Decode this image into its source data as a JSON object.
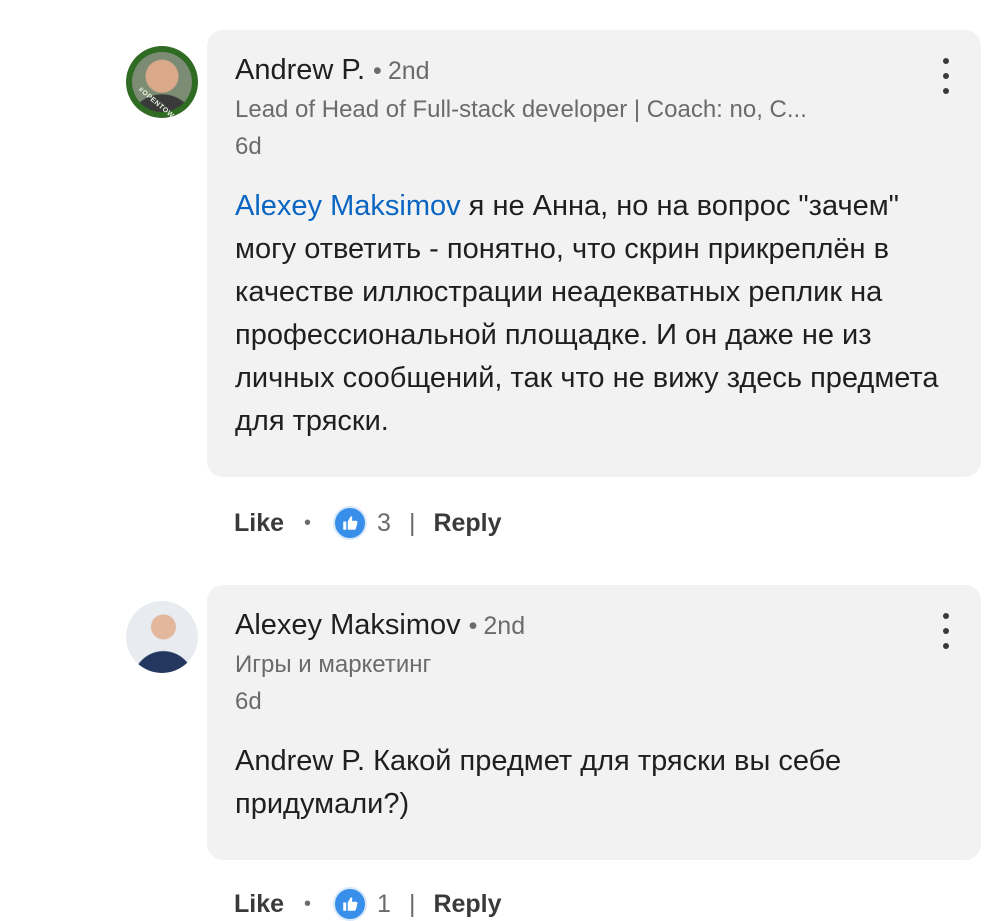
{
  "comments": [
    {
      "author": "Andrew P.",
      "degree": "2nd",
      "headline": "Lead of Head of Full-stack developer | Coach: no, C...",
      "time": "6d",
      "mention": "Alexey Maksimov",
      "text": " я не Анна, но на вопрос \"зачем\" могу ответить - понятно, что скрин прикреплён в качестве иллюстрации неадекватных реплик на профессиональной площадке. И он даже не из личных сообщений, так что не вижу здесь предмета для тряски.",
      "avatar_badge": "#OPENTOWORK",
      "like_label": "Like",
      "reaction_count": "3",
      "reply_label": "Reply"
    },
    {
      "author": "Alexey Maksimov",
      "degree": "2nd",
      "headline": "Игры и маркетинг",
      "time": "6d",
      "text": "Andrew P. Какой предмет для тряски вы себе придумали?)",
      "like_label": "Like",
      "reaction_count": "1",
      "reply_label": "Reply"
    }
  ],
  "icons": {
    "more": "more-vertical-icon",
    "reaction": "thumbs-up-icon"
  },
  "colors": {
    "mention": "#0a66c2",
    "like_badge": "#378fe9",
    "bubble": "#f2f2f2"
  }
}
